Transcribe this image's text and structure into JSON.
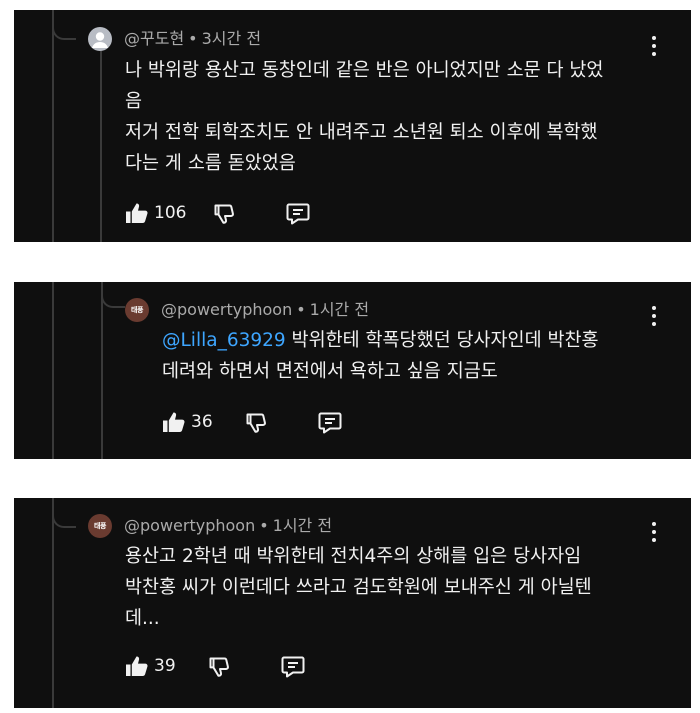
{
  "comments": [
    {
      "avatar": "default-user",
      "author": "@꾸도현",
      "time": "3시간 전",
      "lines": [
        "나 박위랑 용산고 동창인데 같은 반은 아니었지만 소문 다 났었",
        "음",
        "저거 전학 퇴학조치도 안 내려주고 소년원 퇴소 이후에 복학했",
        "다는 게 소름 돋았었음"
      ],
      "likes": "106"
    },
    {
      "avatar_text": "태풍",
      "author": "@powertyphoon",
      "time": "1시간 전",
      "mention": "@Lilla_63929",
      "lines": [
        " 박위한테 학폭당했던 당사자인데 박찬홍",
        "데려와 하면서 면전에서 욕하고 싶음 지금도"
      ],
      "likes": "36"
    },
    {
      "avatar_text": "태풍",
      "author": "@powertyphoon",
      "time": "1시간 전",
      "lines": [
        "용산고 2학년 때 박위한테 전치4주의 상해를 입은 당사자임",
        "박찬홍 씨가 이런데다 쓰라고 검도학원에 보내주신 게 아닐텐",
        "데..."
      ],
      "likes": "39"
    }
  ],
  "meta_separator": "•",
  "icons": [
    "thumbs-up-icon",
    "thumbs-down-icon",
    "reply-icon",
    "more-options-icon"
  ]
}
